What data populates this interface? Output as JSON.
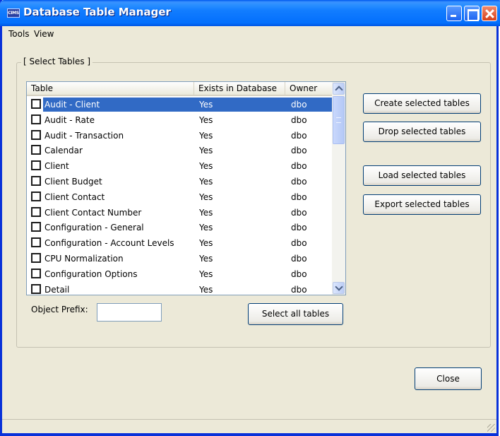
{
  "window": {
    "title": "Database Table Manager",
    "app_icon_text": "CIMS"
  },
  "menu": {
    "tools": "Tools",
    "view": "View"
  },
  "group": {
    "title": "[ Select Tables ]"
  },
  "table_list": {
    "columns": [
      "Table",
      "Exists in Database",
      "Owner"
    ],
    "rows": [
      {
        "name": "Audit - Client",
        "exists": "Yes",
        "owner": "dbo",
        "checked": false,
        "selected": true
      },
      {
        "name": "Audit - Rate",
        "exists": "Yes",
        "owner": "dbo",
        "checked": false,
        "selected": false
      },
      {
        "name": "Audit - Transaction",
        "exists": "Yes",
        "owner": "dbo",
        "checked": false,
        "selected": false
      },
      {
        "name": "Calendar",
        "exists": "Yes",
        "owner": "dbo",
        "checked": false,
        "selected": false
      },
      {
        "name": "Client",
        "exists": "Yes",
        "owner": "dbo",
        "checked": false,
        "selected": false
      },
      {
        "name": "Client Budget",
        "exists": "Yes",
        "owner": "dbo",
        "checked": false,
        "selected": false
      },
      {
        "name": "Client Contact",
        "exists": "Yes",
        "owner": "dbo",
        "checked": false,
        "selected": false
      },
      {
        "name": "Client Contact Number",
        "exists": "Yes",
        "owner": "dbo",
        "checked": false,
        "selected": false
      },
      {
        "name": "Configuration - General",
        "exists": "Yes",
        "owner": "dbo",
        "checked": false,
        "selected": false
      },
      {
        "name": "Configuration - Account Levels",
        "exists": "Yes",
        "owner": "dbo",
        "checked": false,
        "selected": false
      },
      {
        "name": "CPU Normalization",
        "exists": "Yes",
        "owner": "dbo",
        "checked": false,
        "selected": false
      },
      {
        "name": "Configuration Options",
        "exists": "Yes",
        "owner": "dbo",
        "checked": false,
        "selected": false
      },
      {
        "name": "Detail",
        "exists": "Yes",
        "owner": "dbo",
        "checked": false,
        "selected": false
      }
    ]
  },
  "buttons": {
    "create": "Create selected tables",
    "drop": "Drop selected tables",
    "load": "Load selected tables",
    "export": "Export selected tables",
    "select_all": "Select all tables",
    "close": "Close"
  },
  "prefix": {
    "label": "Object Prefix:",
    "value": ""
  }
}
